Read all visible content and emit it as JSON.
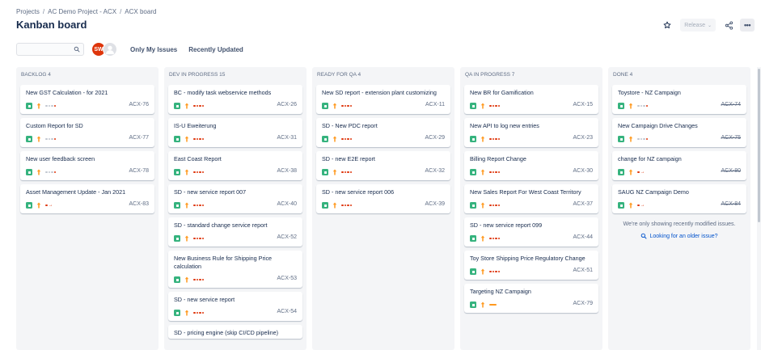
{
  "breadcrumb": [
    "Projects",
    "AC Demo Project - ACX",
    "ACX board"
  ],
  "page_title": "Kanban board",
  "header_actions": {
    "release_label": "Release",
    "icons": [
      "star-icon",
      "chevron-down-icon",
      "share-icon",
      "more-icon"
    ]
  },
  "toolbar": {
    "search": {
      "value": "",
      "placeholder": ""
    },
    "avatar_initials": "SW",
    "filters": [
      "Only My Issues",
      "Recently Updated"
    ]
  },
  "colors": {
    "story": "#36b37e",
    "priority_high": "#ff5630",
    "priority_medium": "#ff991f",
    "link": "#0052cc",
    "avatar": "#de350b"
  },
  "columns": [
    {
      "title": "BACKLOG 4",
      "cards": [
        {
          "title": "New GST Calculation - for 2021",
          "key": "ACX-76",
          "est": "partial"
        },
        {
          "title": "Custom Report for SD",
          "key": "ACX-77",
          "est": "partial"
        },
        {
          "title": "New user feedback screen",
          "key": "ACX-78",
          "est": "partial"
        },
        {
          "title": "Asset Management Update - Jan 2021",
          "key": "ACX-83",
          "est": "arrow"
        }
      ]
    },
    {
      "title": "DEV IN PROGRESS 15",
      "cards": [
        {
          "title": "BC - modify task webservice methods",
          "key": "ACX-26",
          "est": "full"
        },
        {
          "title": "IS-U Eweiterung",
          "key": "ACX-31",
          "est": "full"
        },
        {
          "title": "East Coast Report",
          "key": "ACX-38",
          "est": "full"
        },
        {
          "title": "SD - new service report 007",
          "key": "ACX-40",
          "est": "full"
        },
        {
          "title": "SD - standard change service report",
          "key": "ACX-52",
          "est": "full"
        },
        {
          "title": "New Business Rule for Shipping Price calculation",
          "key": "ACX-53",
          "est": "full"
        },
        {
          "title": "SD - new service report",
          "key": "ACX-54",
          "est": "full"
        },
        {
          "title": "SD - pricing engine (skip CI/CD pipeline)",
          "key": "",
          "est": ""
        }
      ]
    },
    {
      "title": "READY FOR QA 4",
      "cards": [
        {
          "title": "New SD report - extension plant customizing",
          "key": "ACX-11",
          "est": "full"
        },
        {
          "title": "SD - New PDC report",
          "key": "ACX-29",
          "est": "full"
        },
        {
          "title": "SD - new E2E report",
          "key": "ACX-32",
          "est": "full"
        },
        {
          "title": "SD - new service report 006",
          "key": "ACX-39",
          "est": "full"
        }
      ]
    },
    {
      "title": "QA IN PROGRESS 7",
      "cards": [
        {
          "title": "New BR for Gamification",
          "key": "ACX-15",
          "est": "full"
        },
        {
          "title": "New API to log new entries",
          "key": "ACX-23",
          "est": "full"
        },
        {
          "title": "Billing Report Change",
          "key": "ACX-30",
          "est": "full"
        },
        {
          "title": "New Sales Report For West Coast Territory",
          "key": "ACX-37",
          "est": "full"
        },
        {
          "title": "SD - new service report 099",
          "key": "ACX-44",
          "est": "full"
        },
        {
          "title": "Toy Store Shipping Price Regulatory Change",
          "key": "ACX-51",
          "est": "full"
        },
        {
          "title": "Targeting NZ Campaign",
          "key": "ACX-79",
          "est": "orange"
        }
      ]
    },
    {
      "title": "DONE 4",
      "cards": [
        {
          "title": "Toystore - NZ Campaign",
          "key": "ACX-74",
          "est": "partial"
        },
        {
          "title": "New Campaign Drive Changes",
          "key": "ACX-75",
          "est": "partial"
        },
        {
          "title": "change for NZ campaign",
          "key": "ACX-80",
          "est": "arrow"
        },
        {
          "title": "SAUG NZ Campaign Demo",
          "key": "ACX-84",
          "est": "arrow"
        }
      ],
      "note": "We're only showing recently modified issues.",
      "link": "Looking for an older issue?"
    }
  ]
}
